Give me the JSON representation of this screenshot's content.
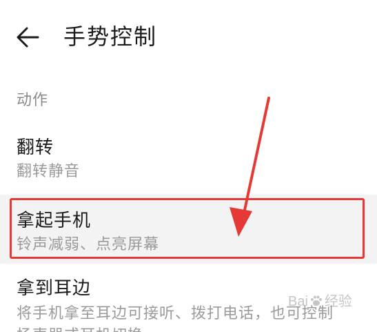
{
  "header": {
    "title": "手势控制",
    "back_icon": "arrow-left-icon"
  },
  "section": {
    "label": "动作"
  },
  "items": [
    {
      "title": "翻转",
      "subtitle": "翻转静音"
    },
    {
      "title": "拿起手机",
      "subtitle": "铃声减弱、点亮屏幕"
    },
    {
      "title": "拿到耳边",
      "subtitle": "将手机拿至耳边可接听、拨打电话，也可控制",
      "subtitle_cont": "扬声器或耳机切换"
    }
  ],
  "watermark": {
    "text_left": "Bai",
    "text_right": "经验"
  },
  "colors": {
    "annotation_red": "#e53935",
    "highlight_row": "#f3f3f3"
  }
}
